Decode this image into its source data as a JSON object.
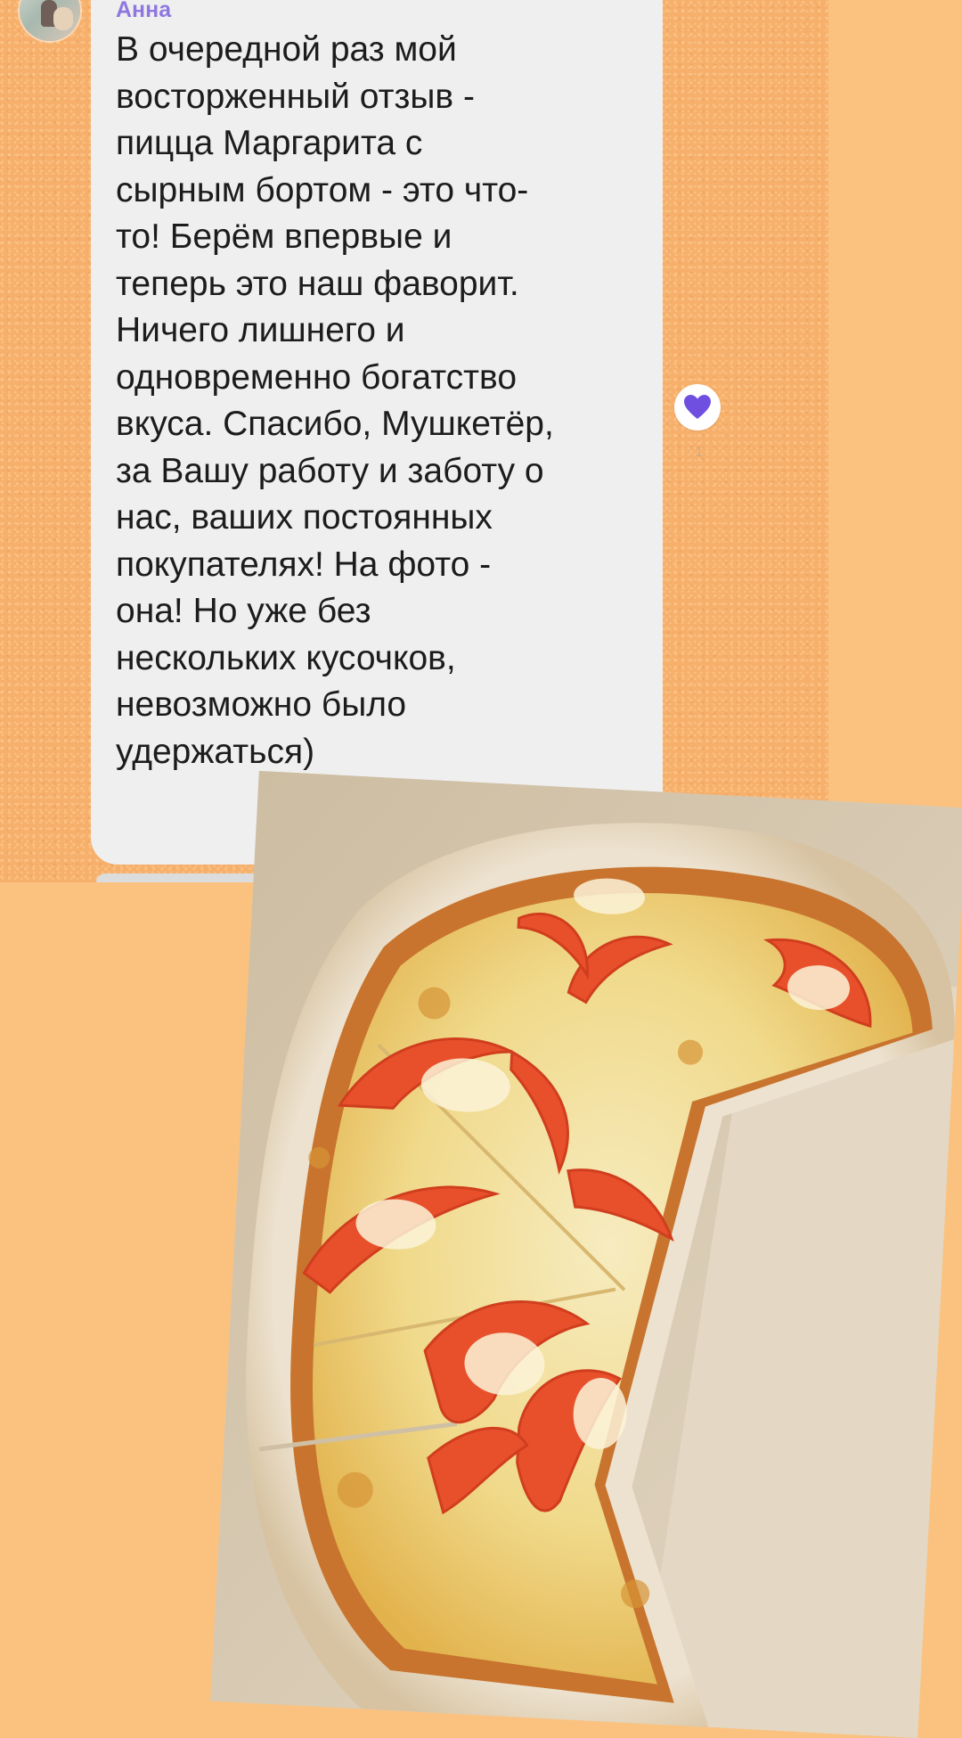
{
  "chat": {
    "author": "Анна",
    "message": "В очередной раз мой\nвосторженный отзыв -\nпицца Маргарита с\nсырным бортом - это что-\nто! Берём впервые и\nтеперь это наш фаворит.\nНичего лишнего и\nодновременно богатство\nвкуса. Спасибо, Мушкетёр,\nза Вашу работу и заботу о\nнас, ваших постоянных\nпокупателях! На фото -\nона! Но уже без\nнескольких кусочков,\nневозможно было\nудержаться)",
    "likes": "1"
  },
  "colors": {
    "page_background": "#fbc27f",
    "wallpaper": "#f7b06c",
    "bubble": "#efefef",
    "author_name": "#8e78e0",
    "heart": "#6f4fe0"
  },
  "icons": {
    "heart": "heart-icon",
    "avatar": "avatar"
  },
  "photo": {
    "subject": "pizza-photo"
  }
}
